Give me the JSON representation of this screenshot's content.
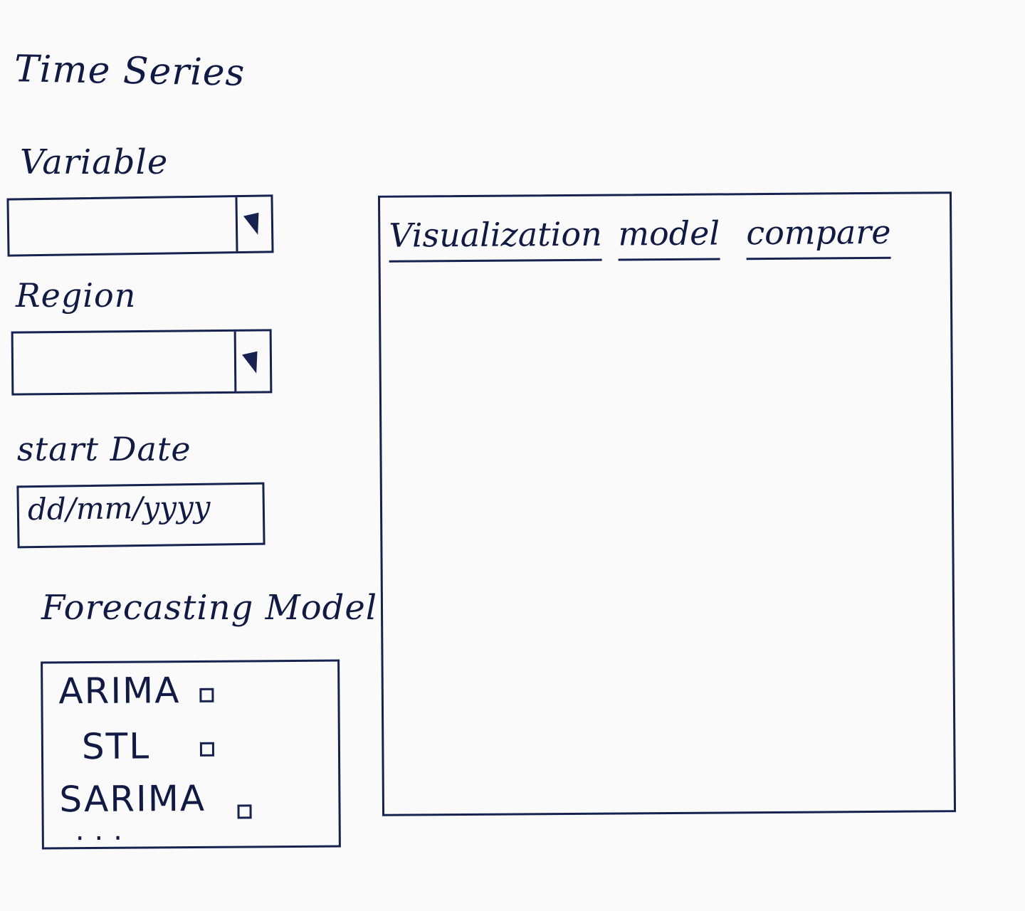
{
  "app": {
    "title": "Time Series"
  },
  "filters": {
    "variable": {
      "label": "Variable",
      "value": ""
    },
    "region": {
      "label": "Region",
      "value": ""
    },
    "start_date": {
      "label": "start Date",
      "placeholder": "dd/mm/yyyy"
    }
  },
  "forecasting": {
    "label": "Forecasting Model",
    "models": [
      {
        "label": "ARIMA",
        "checked": false
      },
      {
        "label": "STL",
        "checked": false
      },
      {
        "label": "SARIMA",
        "checked": false
      }
    ],
    "more": "..."
  },
  "panel": {
    "tabs": [
      {
        "label": "Visualization"
      },
      {
        "label": "model"
      },
      {
        "label": "compare"
      }
    ]
  },
  "colors": {
    "ink": "#16224f",
    "paper": "#fafafa"
  },
  "icons": {
    "dropdown": "chevron-down-icon"
  }
}
